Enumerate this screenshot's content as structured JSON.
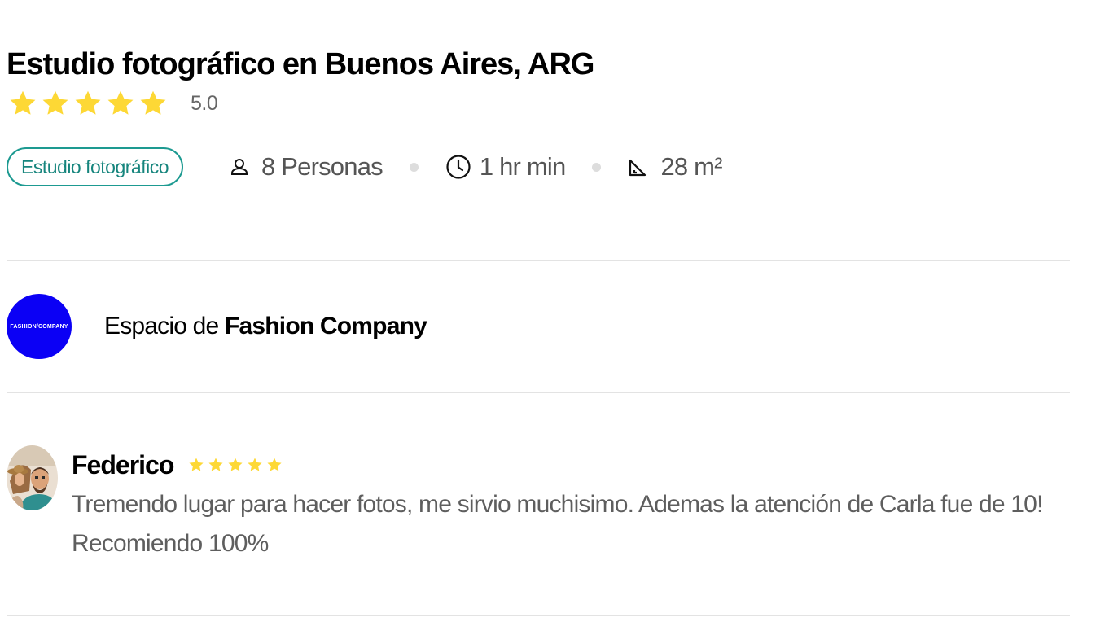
{
  "listing": {
    "title": "Estudio fotográfico en Buenos Aires, ARG",
    "rating": {
      "stars": 5,
      "value": "5.0",
      "star_color": "#fdd835"
    },
    "category": "Estudio fotográfico",
    "capacity": "8 Personas",
    "duration": "1 hr min",
    "area": "28 m²"
  },
  "host": {
    "prefix": "Espacio de ",
    "name": "Fashion Company",
    "logo_text": "FASHION/COMPANY",
    "logo_color": "#0b00f5"
  },
  "review": {
    "author": "Federico",
    "stars": 5,
    "text": "Tremendo lugar para hacer fotos, me sirvio muchisimo. Ademas la atención de Carla fue de 10! Recomiendo 100%"
  },
  "icons": {
    "capacity": "person-icon",
    "duration": "clock-icon",
    "area": "set-square-icon",
    "rating": "star-icon"
  },
  "colors": {
    "accent": "#1d9a91",
    "star": "#fdd835",
    "muted_text": "#5e5e5e",
    "divider": "#e3e3e3"
  }
}
